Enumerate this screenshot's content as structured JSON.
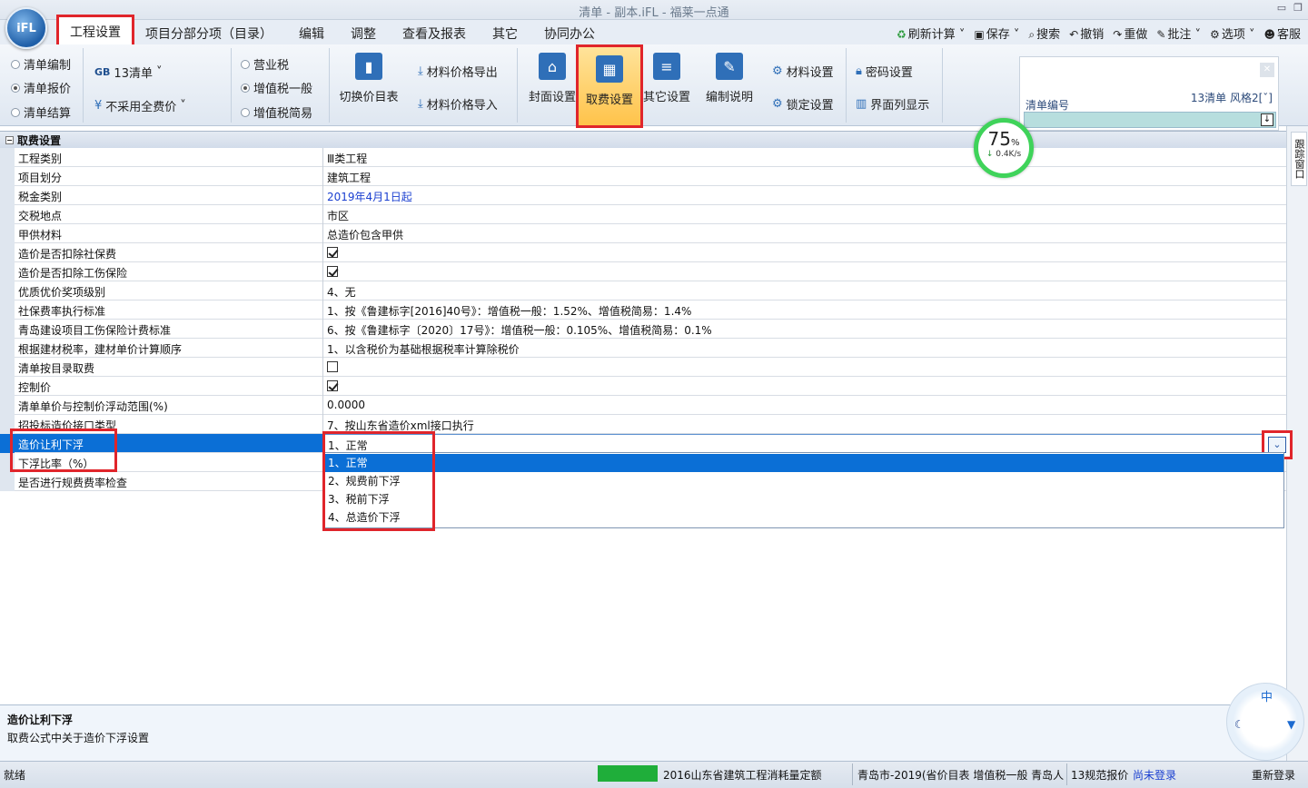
{
  "window": {
    "title": "清单 - 副本.iFL - 福莱一点通"
  },
  "logo": {
    "text": "iFL"
  },
  "menu": {
    "items": [
      "工程设置",
      "项目分部分项（目录）",
      "编辑",
      "调整",
      "查看及报表",
      "其它",
      "协同办公"
    ]
  },
  "toolbar_right": {
    "items": [
      {
        "icon": "recycle-icon",
        "label": "刷新计算"
      },
      {
        "icon": "save-icon",
        "label": "保存"
      },
      {
        "icon": "search-icon",
        "label": "搜索"
      },
      {
        "icon": "undo-icon",
        "label": "撤销"
      },
      {
        "icon": "redo-icon",
        "label": "重做"
      },
      {
        "icon": "pen-icon",
        "label": "批注"
      },
      {
        "icon": "gear-icon",
        "label": "选项"
      },
      {
        "icon": "user-icon",
        "label": "客服"
      }
    ]
  },
  "ribbon": {
    "mode": {
      "options": [
        "清单编制",
        "清单报价",
        "清单结算"
      ],
      "selected": "清单报价"
    },
    "standard": {
      "label": "13清单",
      "prefix": "GB",
      "pricing": "不采用全费价"
    },
    "tax": {
      "options": [
        "营业税",
        "增值税一般",
        "增值税简易"
      ],
      "selected": "增值税一般"
    },
    "switch_price": "切换价目表",
    "export_price": "材料价格导出",
    "import_price": "材料价格导入",
    "cover": "封面设置",
    "fee": "取费设置",
    "other": "其它设置",
    "notes": "编制说明",
    "material_settings": "材料设置",
    "lock_settings": "锁定设置",
    "password_settings": "密码设置",
    "column_display": "界面列显示"
  },
  "search_panel": {
    "label": "清单编号",
    "style": "13清单  风格2[ˇ]"
  },
  "gauge": {
    "percent": "75",
    "unit": "%",
    "speed": "0.4K/s"
  },
  "grid": {
    "section": "取费设置",
    "rows": [
      {
        "key": "工程类别",
        "value": "Ⅲ类工程"
      },
      {
        "key": "项目划分",
        "value": "建筑工程"
      },
      {
        "key": "税金类别",
        "value": "2019年4月1日起"
      },
      {
        "key": "交税地点",
        "value": "市区"
      },
      {
        "key": "甲供材料",
        "value": "总造价包含甲供"
      },
      {
        "key": "造价是否扣除社保费",
        "value": ""
      },
      {
        "key": "造价是否扣除工伤保险",
        "value": ""
      },
      {
        "key": "优质优价奖项级别",
        "value": "4、无"
      },
      {
        "key": "社保费率执行标准",
        "value": "1、按《鲁建标字[2016]40号》：增值税一般：1.52%、增值税简易：1.4%"
      },
      {
        "key": "青岛建设项目工伤保险计费标准",
        "value": "6、按《鲁建标字〔2020〕17号》：增值税一般：0.105%、增值税简易：0.1%"
      },
      {
        "key": "根据建材税率，建材单价计算顺序",
        "value": "1、以含税价为基础根据税率计算除税价"
      },
      {
        "key": "清单按目录取费",
        "value": ""
      },
      {
        "key": "控制价",
        "value": ""
      },
      {
        "key": "清单单价与控制价浮动范围(%)",
        "value": "0.0000"
      },
      {
        "key": "招投标造价接口类型",
        "value": "7、按山东省造价xml接口执行"
      },
      {
        "key": "造价让利下浮",
        "value": "1、正常"
      },
      {
        "key": "下浮比率（%）",
        "value": ""
      },
      {
        "key": "是否进行规费费率检查",
        "value": ""
      }
    ],
    "dropdown_options": [
      "1、正常",
      "2、规费前下浮",
      "3、税前下浮",
      "4、总造价下浮"
    ]
  },
  "side_tab": "跟踪窗口",
  "description": {
    "title": "造价让利下浮",
    "text": "取费公式中关于造价下浮设置"
  },
  "ime": {
    "label": "中"
  },
  "statusbar": {
    "ready": "就绪",
    "quota": "2016山东省建筑工程消耗量定额",
    "region": "青岛市-2019(省价目表 增值税一般 青岛人",
    "standard": "13规范报价",
    "login": "尚未登录",
    "relogin": "重新登录"
  },
  "colors": {
    "accent": "#0b6fd6",
    "highlight": "#e0252b",
    "progress": "#1fae3a"
  }
}
